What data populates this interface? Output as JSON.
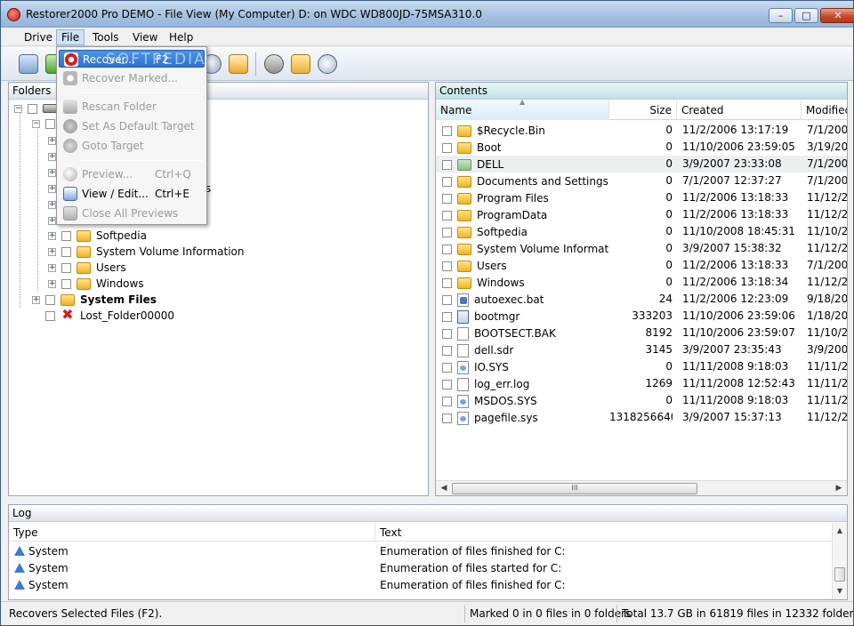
{
  "window": {
    "title": "Restorer2000 Pro DEMO - File View (My Computer) D: on WDC WD800JD-75MSA310.0",
    "minimize_glyph": "–",
    "maximize_glyph": "□",
    "close_glyph": "✕"
  },
  "menubar": {
    "items": [
      "Drive",
      "File",
      "Tools",
      "View",
      "Help"
    ]
  },
  "file_menu": {
    "items": [
      {
        "label": "Recover...",
        "shortcut": "F2"
      },
      {
        "label": "Recover Marked...",
        "shortcut": ""
      },
      {
        "label": "Rescan Folder",
        "shortcut": ""
      },
      {
        "label": "Set As Default Target",
        "shortcut": ""
      },
      {
        "label": "Goto Target",
        "shortcut": ""
      },
      {
        "label": "Preview...",
        "shortcut": "Ctrl+Q"
      },
      {
        "label": "View / Edit...",
        "shortcut": "Ctrl+E"
      },
      {
        "label": "Close All Previews",
        "shortcut": ""
      }
    ],
    "watermark": "SOFTPEDIA"
  },
  "folders_pane": {
    "header": "Folders",
    "tree": [
      {
        "label": "Softpedia",
        "bold": false
      },
      {
        "label": "System Volume Information",
        "bold": false
      },
      {
        "label": "Users",
        "bold": false
      },
      {
        "label": "Windows",
        "bold": false
      },
      {
        "label": "System Files",
        "bold": true
      },
      {
        "label": "Lost_Folder00000",
        "bold": false
      }
    ],
    "partial_label": "s"
  },
  "contents_pane": {
    "header": "Contents",
    "columns": [
      "Name",
      "Size",
      "Created",
      "Modified"
    ],
    "rows": [
      {
        "name": "$Recycle.Bin",
        "size": "0",
        "created": "11/2/2006 13:17:19",
        "modified": "7/1/2007",
        "icon": "folder"
      },
      {
        "name": "Boot",
        "size": "0",
        "created": "11/10/2006 23:59:05",
        "modified": "3/19/200",
        "icon": "folder"
      },
      {
        "name": "DELL",
        "size": "0",
        "created": "3/9/2007 23:33:08",
        "modified": "7/1/2007",
        "icon": "folder-dell"
      },
      {
        "name": "Documents and Settings",
        "size": "0",
        "created": "7/1/2007 12:37:27",
        "modified": "7/1/2007",
        "icon": "folder"
      },
      {
        "name": "Program Files",
        "size": "0",
        "created": "11/2/2006 13:18:33",
        "modified": "11/12/20",
        "icon": "folder"
      },
      {
        "name": "ProgramData",
        "size": "0",
        "created": "11/2/2006 13:18:33",
        "modified": "11/12/20",
        "icon": "folder"
      },
      {
        "name": "Softpedia",
        "size": "0",
        "created": "11/10/2008 18:45:31",
        "modified": "11/10/20",
        "icon": "folder"
      },
      {
        "name": "System Volume Information",
        "size": "0",
        "created": "3/9/2007 15:38:32",
        "modified": "11/12/20",
        "icon": "folder"
      },
      {
        "name": "Users",
        "size": "0",
        "created": "11/2/2006 13:18:33",
        "modified": "7/1/2007",
        "icon": "folder"
      },
      {
        "name": "Windows",
        "size": "0",
        "created": "11/2/2006 13:18:34",
        "modified": "11/12/20",
        "icon": "folder"
      },
      {
        "name": "autoexec.bat",
        "size": "24",
        "created": "11/2/2006 12:23:09",
        "modified": "9/18/200",
        "icon": "bat"
      },
      {
        "name": "bootmgr",
        "size": "333203",
        "created": "11/10/2006 23:59:06",
        "modified": "1/18/200",
        "icon": "exe"
      },
      {
        "name": "BOOTSECT.BAK",
        "size": "8192",
        "created": "11/10/2006 23:59:07",
        "modified": "11/10/20",
        "icon": "file"
      },
      {
        "name": "dell.sdr",
        "size": "3145",
        "created": "3/9/2007 23:35:43",
        "modified": "3/9/2007",
        "icon": "file"
      },
      {
        "name": "IO.SYS",
        "size": "0",
        "created": "11/11/2008 9:18:03",
        "modified": "11/11/20",
        "icon": "sys"
      },
      {
        "name": "log_err.log",
        "size": "1269",
        "created": "11/11/2008 12:52:43",
        "modified": "11/11/20",
        "icon": "file"
      },
      {
        "name": "MSDOS.SYS",
        "size": "0",
        "created": "11/11/2008 9:18:03",
        "modified": "11/11/20",
        "icon": "sys"
      },
      {
        "name": "pagefile.sys",
        "size": "1318256640",
        "created": "3/9/2007 15:37:13",
        "modified": "11/12/20",
        "icon": "sys"
      }
    ],
    "hscroll_thumb": "III"
  },
  "log_pane": {
    "header": "Log",
    "columns": [
      "Type",
      "Text"
    ],
    "rows": [
      {
        "type": "System",
        "text": "Enumeration of files finished for C:"
      },
      {
        "type": "System",
        "text": "Enumeration of files started for C:"
      },
      {
        "type": "System",
        "text": "Enumeration of files finished for C:"
      }
    ]
  },
  "statusbar": {
    "hint": "Recovers Selected Files (F2).",
    "marked": "Marked 0 in 0 files in 0 folders",
    "total": "Total 13.7 GB in 61819 files in 12332 folders"
  }
}
